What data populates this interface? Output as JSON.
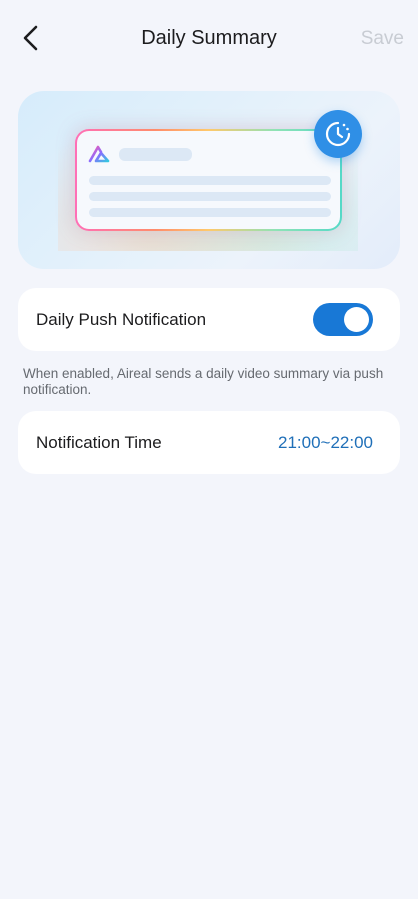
{
  "header": {
    "title": "Daily Summary",
    "save_label": "Save"
  },
  "hero": {
    "app_icon": "aireal-logo",
    "badge_icon": "clock-icon"
  },
  "push_setting": {
    "label": "Daily Push Notification",
    "enabled": true,
    "hint": "When enabled, Aireal sends a daily video summary via push notification."
  },
  "time_setting": {
    "label": "Notification Time",
    "value": "21:00~22:00"
  },
  "colors": {
    "accent": "#1878d6",
    "time_value": "#1f6fb8",
    "save_disabled": "#c8ccd3",
    "background": "#f3f5fb"
  }
}
